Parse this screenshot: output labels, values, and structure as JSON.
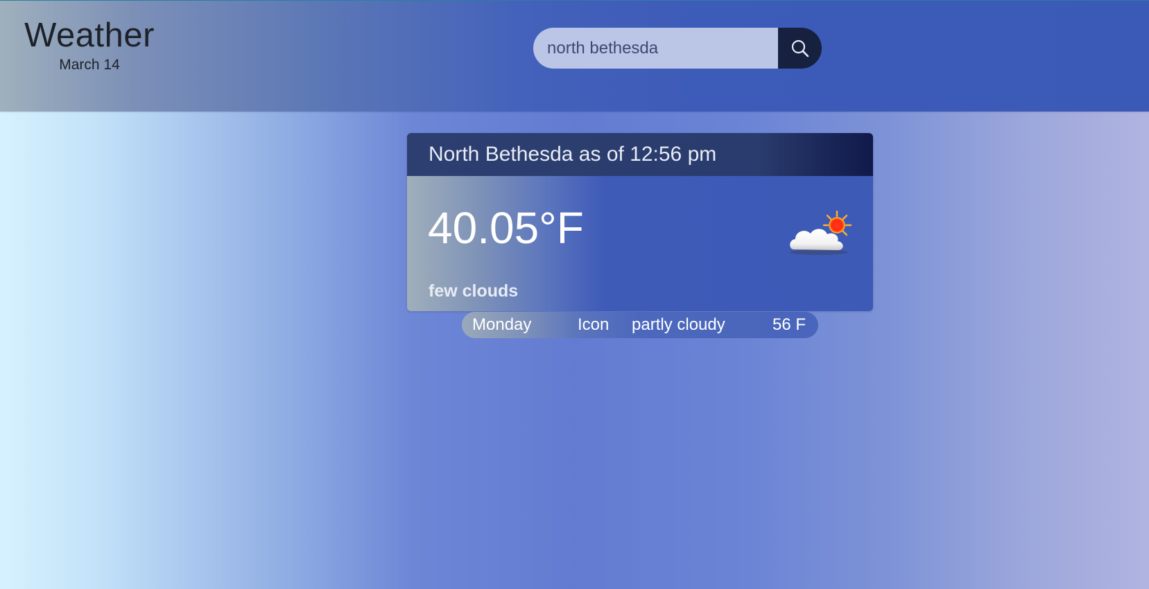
{
  "app": {
    "title": "Weather",
    "date": "March 14"
  },
  "search": {
    "value": "north bethesda",
    "icon": "search-icon"
  },
  "current": {
    "header": "North Bethesda as of 12:56 pm",
    "temperature": "40.05°F",
    "description": "few clouds",
    "icon": "partly-cloudy-icon"
  },
  "forecast": [
    {
      "day": "Monday",
      "icon_label": "Icon",
      "condition": "partly cloudy",
      "temp": "56 F"
    }
  ],
  "colors": {
    "header_bar": "#3b59b7",
    "search_button": "#16213f",
    "card_header": "#2a3c6d"
  }
}
